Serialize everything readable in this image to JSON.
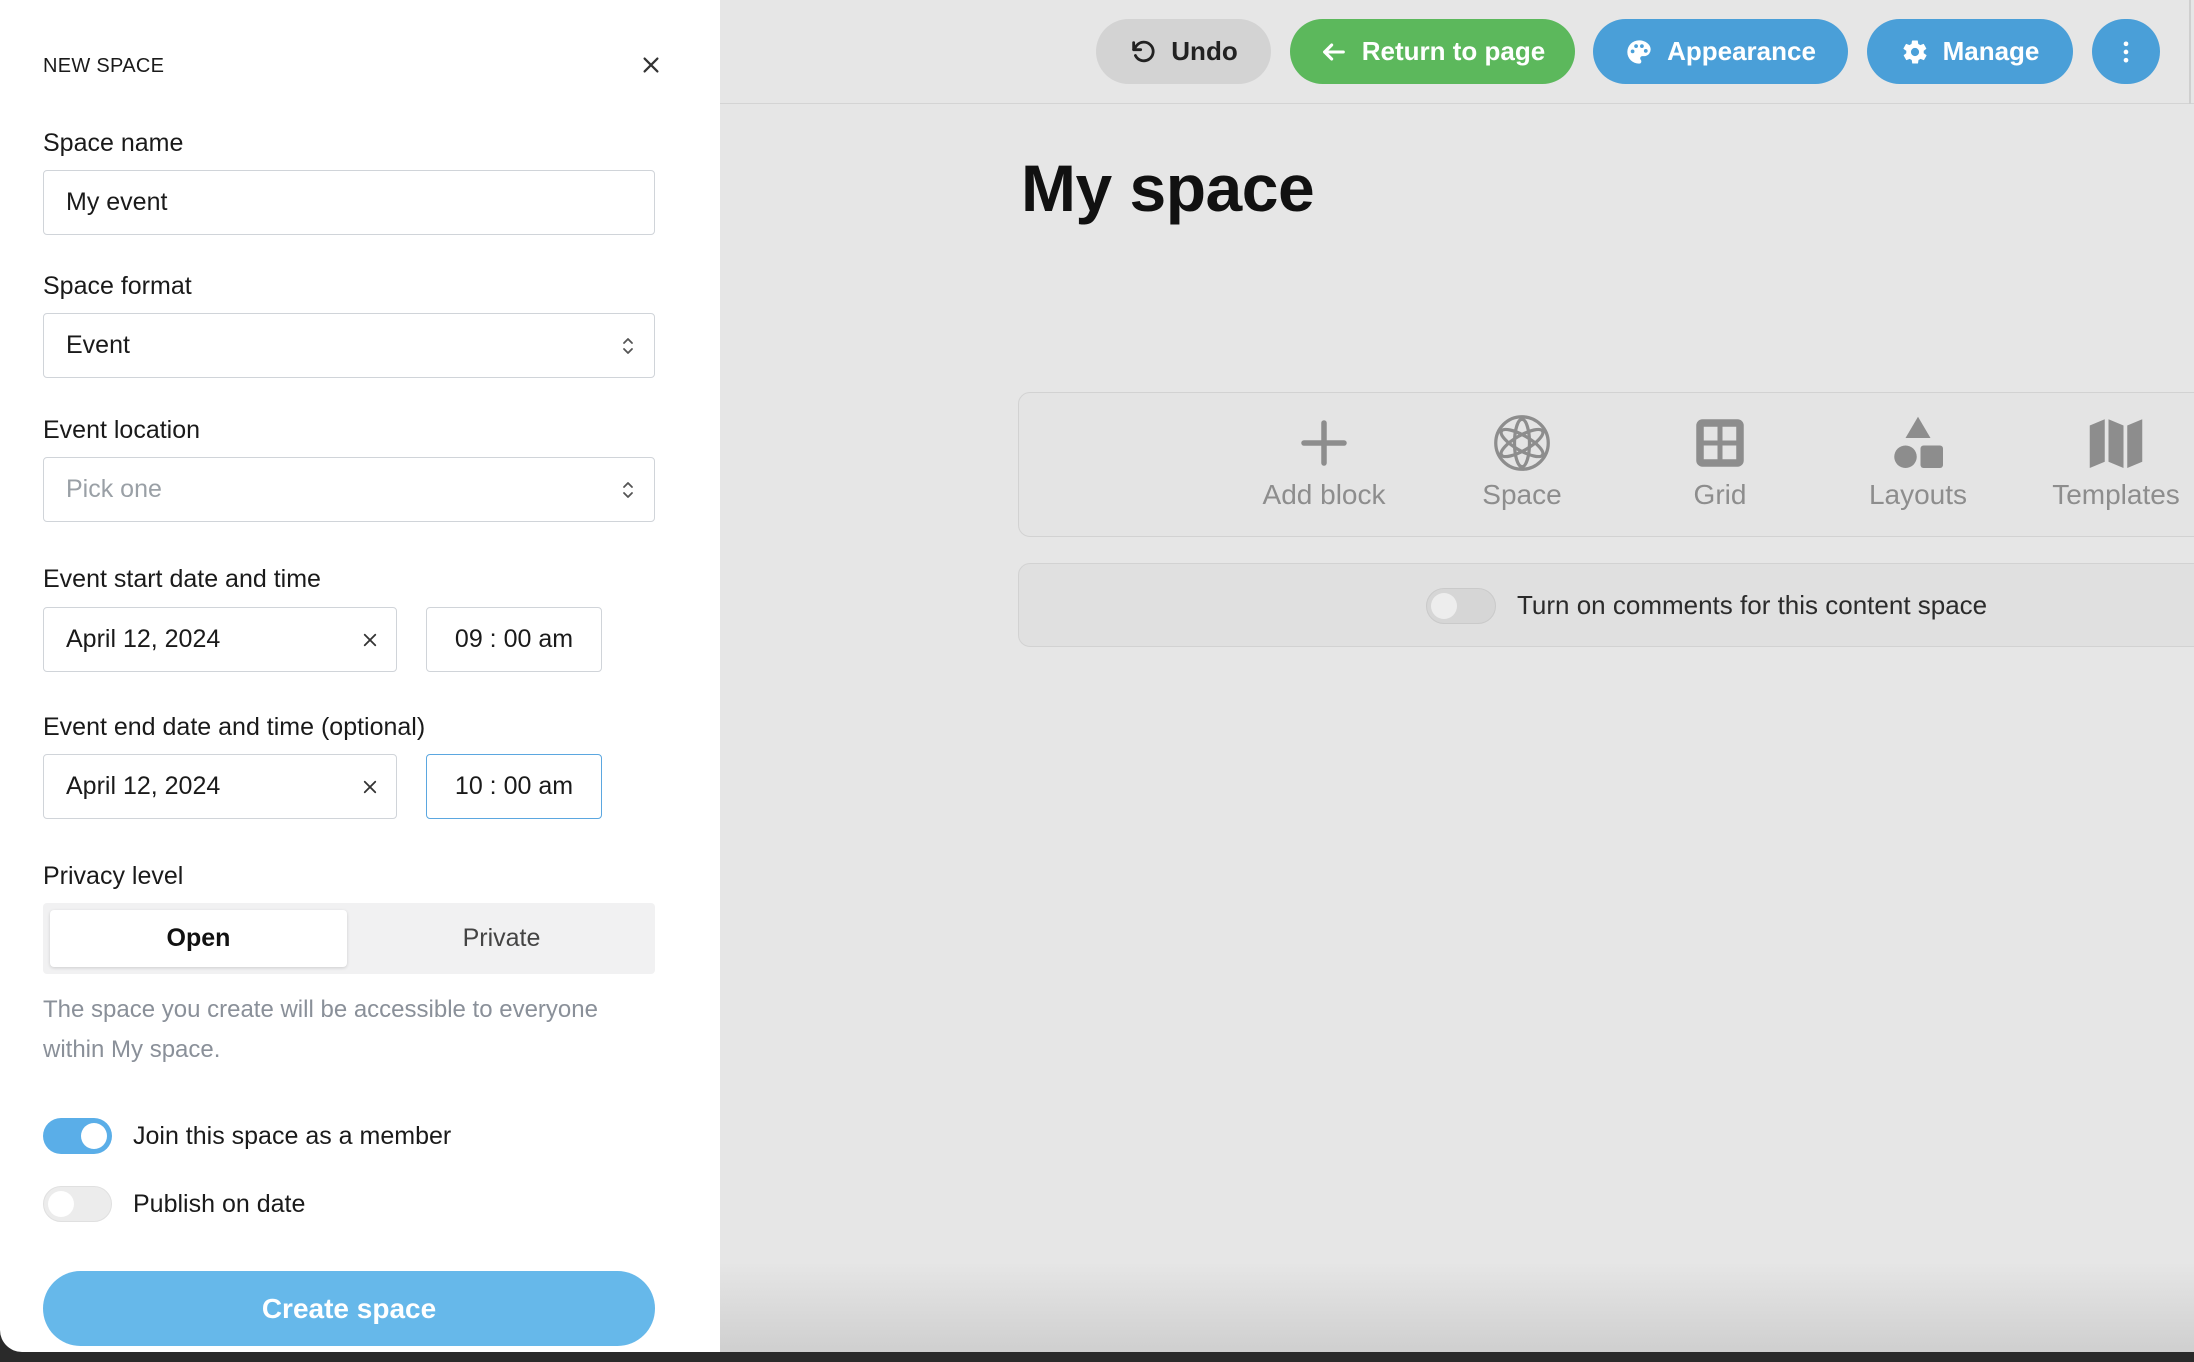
{
  "panel": {
    "title": "NEW SPACE",
    "space_name": {
      "label": "Space name",
      "value": "My event"
    },
    "space_format": {
      "label": "Space format",
      "value": "Event"
    },
    "event_location": {
      "label": "Event location",
      "placeholder": "Pick one"
    },
    "event_start": {
      "label": "Event start date and time",
      "date": "April 12, 2024",
      "time": "09 : 00 am"
    },
    "event_end": {
      "label": "Event end date and time (optional)",
      "date": "April 12, 2024",
      "time": "10 : 00 am"
    },
    "privacy": {
      "label": "Privacy level",
      "options": [
        "Open",
        "Private"
      ],
      "selected": "Open",
      "help": "The space you create will be accessible to everyone within My space."
    },
    "toggles": {
      "join_label": "Join this space as a member",
      "join_on": true,
      "publish_label": "Publish on date",
      "publish_on": false
    },
    "create_button": "Create space"
  },
  "toolbar": {
    "undo": "Undo",
    "return": "Return to page",
    "appearance": "Appearance",
    "manage": "Manage"
  },
  "page": {
    "title": "My space",
    "block_bar": {
      "add_block": "Add block",
      "space": "Space",
      "grid": "Grid",
      "layouts": "Layouts",
      "templates": "Templates"
    },
    "comments_label": "Turn on comments for this content space"
  },
  "colors": {
    "green_button": "#5cb85c",
    "blue_button": "#4a9fd8",
    "create_button": "#66b8ea",
    "toggle_on": "#5aaee8"
  }
}
